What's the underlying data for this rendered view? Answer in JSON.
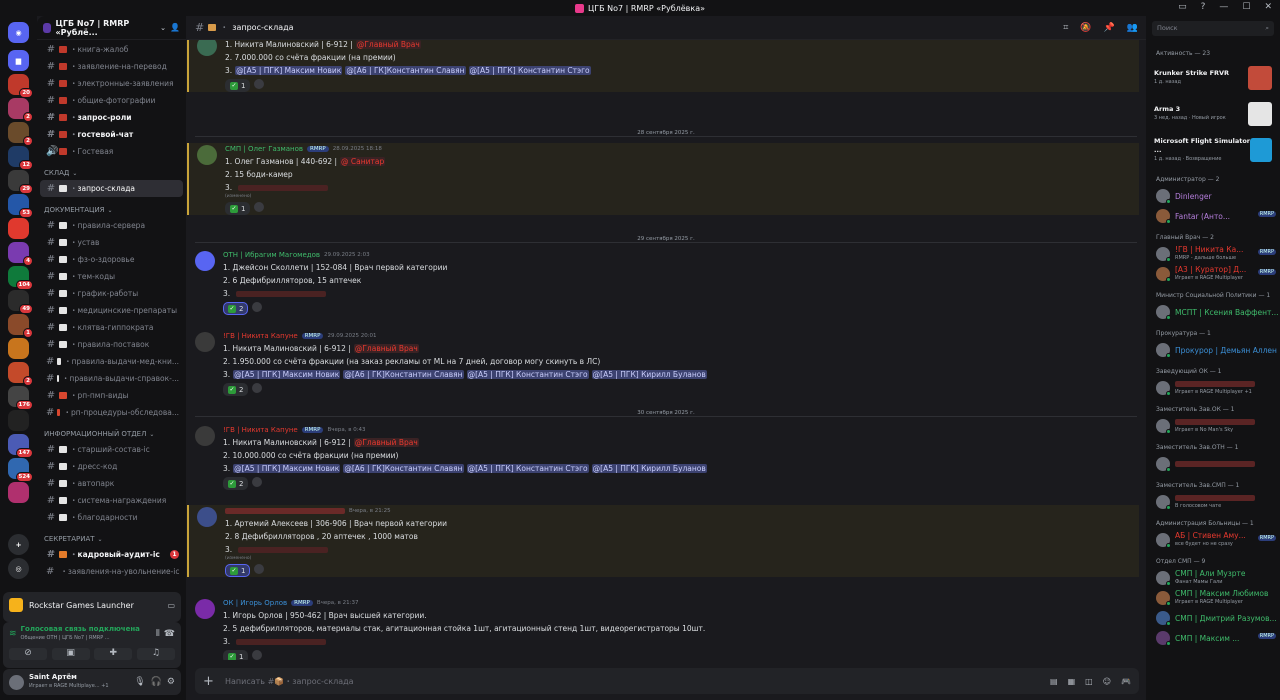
{
  "window": {
    "title": "ЦГБ No7 | RMRP «Рублёвка»"
  },
  "server": {
    "name": "ЦГБ No7 | RMRP «Рублё...",
    "initials": "DC"
  },
  "guild_badges": [
    "20",
    "2",
    "2",
    "12",
    "29",
    "53",
    "",
    "4",
    "104",
    "49",
    "1",
    "",
    "2",
    "176",
    "",
    "147",
    "524",
    ""
  ],
  "channels": {
    "top": [
      {
        "name": "книга-жалоб",
        "unread": false
      },
      {
        "name": "заявление-на-перевод",
        "unread": false
      },
      {
        "name": "электронные-заявления",
        "unread": false
      },
      {
        "name": "общие-фотографии",
        "unread": false
      },
      {
        "name": "запрос-роли",
        "unread": true
      },
      {
        "name": "гостевой-чат",
        "unread": true
      },
      {
        "name": "Гостевая",
        "unread": false
      }
    ],
    "cat_sklad": "СКЛАД",
    "active": "запрос-склада",
    "cat_docs": "Документация",
    "docs": [
      "правила-сервера",
      "устав",
      "фз-о-здоровье",
      "тем-коды",
      "график-работы",
      "медицинские-препараты",
      "клятва-гиппократа",
      "правила-поставок",
      "правила-выдачи-мед-кни...",
      "правила-выдачи-справок-...",
      "рп-пмп-виды",
      "рп-процедуры-обследова..."
    ],
    "cat_info": "Информационный отдел",
    "info": [
      "старший-состав-ic",
      "дресс-код",
      "автопарк",
      "система-награждения",
      "благодарности"
    ],
    "cat_secret": "СЕКРЕТАРИАТ",
    "secret": [
      {
        "name": "кадровый-аудит-ic",
        "unread": true,
        "mention": "1"
      },
      {
        "name": "заявления-на-увольнение-ic",
        "unread": false,
        "mention": ""
      }
    ]
  },
  "activity_panel": {
    "app": "Rockstar Games Launcher"
  },
  "voice": {
    "status": "Голосовая связь подключена",
    "channel": "Общение ОТН | ЦГБ No7 | RMRP ..."
  },
  "user": {
    "name": "Saint Артём",
    "status": "Играет в RAGE Multiplaye...",
    "extra": "+1"
  },
  "header": {
    "channel": "запрос-склада"
  },
  "dates": {
    "d1": "28 сентября 2025 г.",
    "d2": "29 сентября 2025 г.",
    "d3": "30 сентября 2025 г."
  },
  "messages": [
    {
      "lines": [
        "1. Никита Малиновский | 6-912 |",
        "2. 7.000.000 со счёта фракции (на премии)",
        "3."
      ],
      "role": "@Главный Врач",
      "mentions": [
        "@[A5 | ПГК] Максим Новик",
        "@[A6 | ГК]Константин Славян",
        "@[A5 | ПГК] Константин Стэго"
      ],
      "react": "1"
    },
    {
      "author": "СМП | Олег Газманов",
      "tag": "RMRP",
      "time": "28.09.2025 18:18",
      "lines": [
        "1. Олег Газманов | 440-692 |",
        "2. 15 боди-камер",
        "3."
      ],
      "role": "@ Санитар",
      "edited": "(изменено)",
      "react": "1"
    },
    {
      "author": "ОТН | Ибрагим Магомедов",
      "tag": "",
      "time": "29.09.2025 2:03",
      "lines": [
        "1. Джейсон Сколлети | 152-084 |  Врач первой категории",
        "2. 6 Дефибрилляторов, 15 аптечек",
        "3."
      ],
      "react": "2"
    },
    {
      "author": "!ГВ | Никита Капуне",
      "tag": "RMRP",
      "time": "29.09.2025 20:01",
      "lines": [
        "1. Никита Малиновский | 6-912 |",
        "2. 1.950.000 со счёта фракции (на заказ рекламы от ML на 7 дней, договор могу скинуть в ЛС)",
        "3."
      ],
      "role": "@Главный Врач",
      "mentions": [
        "@[A5 | ПГК] Максим Новик",
        "@[A6 | ГК]Константин Славян",
        "@[A5 | ПГК] Константин Стэго",
        "@[A5 | ПГК] Кирилл Буланов"
      ],
      "react": "2"
    },
    {
      "author": "!ГВ | Никита Капуне",
      "tag": "RMRP",
      "time": "Вчера, в 0:43",
      "lines": [
        "1. Никита Малиновский | 6-912 |",
        "2. 10.000.000 со счёта фракции (на премии)",
        "3."
      ],
      "role": "@Главный Врач",
      "mentions": [
        "@[A5 | ПГК] Максим Новик",
        "@[A6 | ГК]Константин Славян",
        "@[A5 | ПГК] Константин Стэго",
        "@[A5 | ПГК] Кирилл Буланов"
      ],
      "react": "2"
    },
    {
      "author": "",
      "tag": "",
      "time": "Вчера, в 21:25",
      "lines": [
        "1. Артемий Алексеев | 306-906 | Врач первой категории",
        "2. 8 Дефибрилляторов , 20 аптечек , 1000 матов",
        "3."
      ],
      "edited": "(изменено)",
      "react": "1"
    },
    {
      "author": "ОК | Игорь Орлов",
      "tag": "RMRP",
      "time": "Вчера, в 21:37",
      "lines": [
        "1. Игорь Орлов | 950-462 | Врач высшей категории.",
        "2. 5 дефибрилляторов, материалы стак, агитационная стойка 1шт, агитационный стенд 1шт, видеорегистраторы 10шт.",
        "3."
      ],
      "react": "1"
    }
  ],
  "input": {
    "placeholder": "Написать #📦・запрос-склада"
  },
  "members": {
    "search_placeholder": "Поиск",
    "activity_header": "Активность — 23",
    "activities": [
      {
        "title": "Krunker Strike FRVR",
        "sub": "1 д. назад",
        "color": "#c24b3a"
      },
      {
        "title": "Arma 3",
        "sub": "3 нед. назад · Новый игрок",
        "color": "#e5e5e5"
      },
      {
        "title": "Microsoft Flight Simulator ...",
        "sub": "1 д. назад · Возвращение",
        "color": "#1e9ad6"
      }
    ],
    "groups": [
      {
        "header": "Администратор — 2",
        "items": [
          {
            "name": "Dinlenger",
            "sub": "",
            "color": "#b57edc"
          },
          {
            "name": "Fantar (Анто...",
            "sub": "",
            "color": "#b57edc",
            "tag": "RMRP"
          }
        ]
      },
      {
        "header": "Главный Врач — 2",
        "items": [
          {
            "name": "!ГВ | Никита Ка...",
            "sub": "RMRP - дальше больше",
            "color": "#e8392f",
            "tag": "RMRP"
          },
          {
            "name": "[A3 | Куратор] Д...",
            "sub": "Играет в RAGE Multiplayer",
            "color": "#e8392f",
            "tag": "RMRP"
          }
        ]
      },
      {
        "header": "Министр Социальной Политики — 1",
        "items": [
          {
            "name": "МСПТ | Ксения Ваффент...",
            "sub": "",
            "color": "#3fbb6b"
          }
        ]
      },
      {
        "header": "Прокуратура — 1",
        "items": [
          {
            "name": "Прокурор | Демьян Аллен",
            "sub": "",
            "color": "#3b8fd6"
          }
        ]
      },
      {
        "header": "Заведующий ОК — 1",
        "items": [
          {
            "name": "",
            "sub": "Играет в RAGE Multiplayer +1",
            "color": "#e8392f"
          }
        ]
      },
      {
        "header": "Заместитель Зав.ОК — 1",
        "items": [
          {
            "name": "",
            "sub": "Играет в No Man's Sky",
            "color": "#e8392f"
          }
        ]
      },
      {
        "header": "Заместитель Зав.ОТН — 1",
        "items": [
          {
            "name": "",
            "sub": "",
            "color": "#e8392f"
          }
        ]
      },
      {
        "header": "Заместитель Зав.СМП — 1",
        "items": [
          {
            "name": "",
            "sub": "В голосовом чате",
            "color": "#e8392f"
          }
        ]
      },
      {
        "header": "Администрация Больницы — 1",
        "items": [
          {
            "name": "АБ | Стивен Аму...",
            "sub": "все будет но не сразу",
            "color": "#e8392f",
            "tag": "RMRP"
          }
        ]
      },
      {
        "header": "Отдел СМП — 9",
        "items": [
          {
            "name": "СМП | Али Музрте",
            "sub": "Фанат Мамы Гали",
            "color": "#3fbb6b"
          },
          {
            "name": "СМП | Максим Любимов",
            "sub": "Играет в RAGE Multiplayer",
            "color": "#3fbb6b"
          },
          {
            "name": "СМП | Дмитрий Разумов...",
            "sub": "",
            "color": "#3fbb6b"
          },
          {
            "name": "СМП | Максим ...",
            "sub": "",
            "color": "#3fbb6b",
            "tag": "RMRP"
          }
        ]
      }
    ]
  }
}
